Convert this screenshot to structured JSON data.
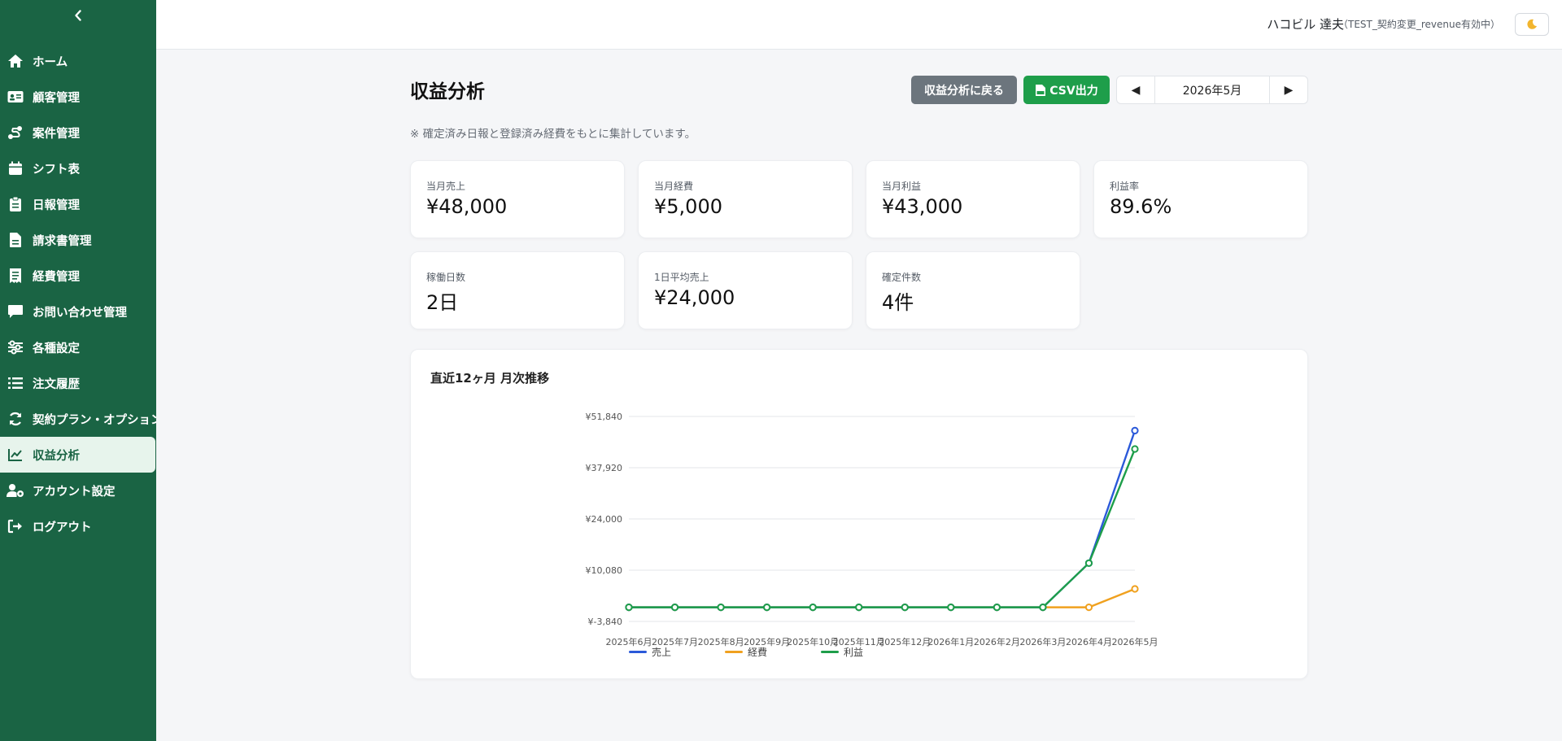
{
  "sidebar": {
    "items": [
      {
        "label": "ホーム",
        "icon": "home-icon"
      },
      {
        "label": "顧客管理",
        "icon": "id-card-icon"
      },
      {
        "label": "案件管理",
        "icon": "route-icon"
      },
      {
        "label": "シフト表",
        "icon": "calendar-icon"
      },
      {
        "label": "日報管理",
        "icon": "clipboard-icon"
      },
      {
        "label": "請求書管理",
        "icon": "invoice-icon"
      },
      {
        "label": "経費管理",
        "icon": "receipt-icon"
      },
      {
        "label": "お問い合わせ管理",
        "icon": "message-icon"
      },
      {
        "label": "各種設定",
        "icon": "sliders-icon"
      },
      {
        "label": "注文履歴",
        "icon": "list-icon"
      },
      {
        "label": "契約プラン・オプション",
        "icon": "refresh-icon"
      },
      {
        "label": "収益分析",
        "icon": "chart-line-icon",
        "active": true
      },
      {
        "label": "アカウント設定",
        "icon": "user-gear-icon"
      },
      {
        "label": "ログアウト",
        "icon": "logout-icon"
      }
    ]
  },
  "topbar": {
    "user_name": "ハコビル 達夫",
    "plan": "（TEST_契約変更_revenue有効中）"
  },
  "main": {
    "title": "収益分析",
    "back_button": "収益分析に戻る",
    "csv_button": "CSV出力",
    "month": "2026年5月",
    "prev_arrow": "◀",
    "next_arrow": "▶",
    "note": "※ 確定済み日報と登録済み経費をもとに集計しています。"
  },
  "stats": [
    {
      "label": "当月売上",
      "value": "¥48,000"
    },
    {
      "label": "当月経費",
      "value": "¥5,000"
    },
    {
      "label": "当月利益",
      "value": "¥43,000"
    },
    {
      "label": "利益率",
      "value": "89.6%"
    },
    {
      "label": "稼働日数",
      "value": "2日"
    },
    {
      "label": "1日平均売上",
      "value": "¥24,000"
    },
    {
      "label": "確定件数",
      "value": "4件"
    }
  ],
  "chart_title": "直近12ヶ月 月次推移",
  "colors": {
    "sidebar": "#1a6444",
    "sales": "#2b59d9",
    "expense": "#f0a11f",
    "profit": "#1e9e4a",
    "back_button": "#6c757d",
    "csv_button": "#1e9e4a"
  },
  "chart_data": {
    "type": "line",
    "title": "直近12ヶ月 月次推移",
    "xlabel": "",
    "ylabel": "",
    "categories": [
      "2025年6月",
      "2025年7月",
      "2025年8月",
      "2025年9月",
      "2025年10月",
      "2025年11月",
      "2025年12月",
      "2026年1月",
      "2026年2月",
      "2026年3月",
      "2026年4月",
      "2026年5月"
    ],
    "yticks": [
      -3840,
      10080,
      24000,
      37920,
      51840
    ],
    "ytick_labels": [
      "¥-3,840",
      "¥10,080",
      "¥24,000",
      "¥37,920",
      "¥51,840"
    ],
    "ylim": [
      -3840,
      51840
    ],
    "grid": true,
    "legend_position": "bottom-left",
    "series": [
      {
        "name": "売上",
        "color": "#2b59d9",
        "values": [
          0,
          0,
          0,
          0,
          0,
          0,
          0,
          0,
          0,
          0,
          12000,
          48000
        ]
      },
      {
        "name": "経費",
        "color": "#f0a11f",
        "values": [
          0,
          0,
          0,
          0,
          0,
          0,
          0,
          0,
          0,
          0,
          0,
          5000
        ]
      },
      {
        "name": "利益",
        "color": "#1e9e4a",
        "values": [
          0,
          0,
          0,
          0,
          0,
          0,
          0,
          0,
          0,
          0,
          12000,
          43000
        ]
      }
    ]
  }
}
